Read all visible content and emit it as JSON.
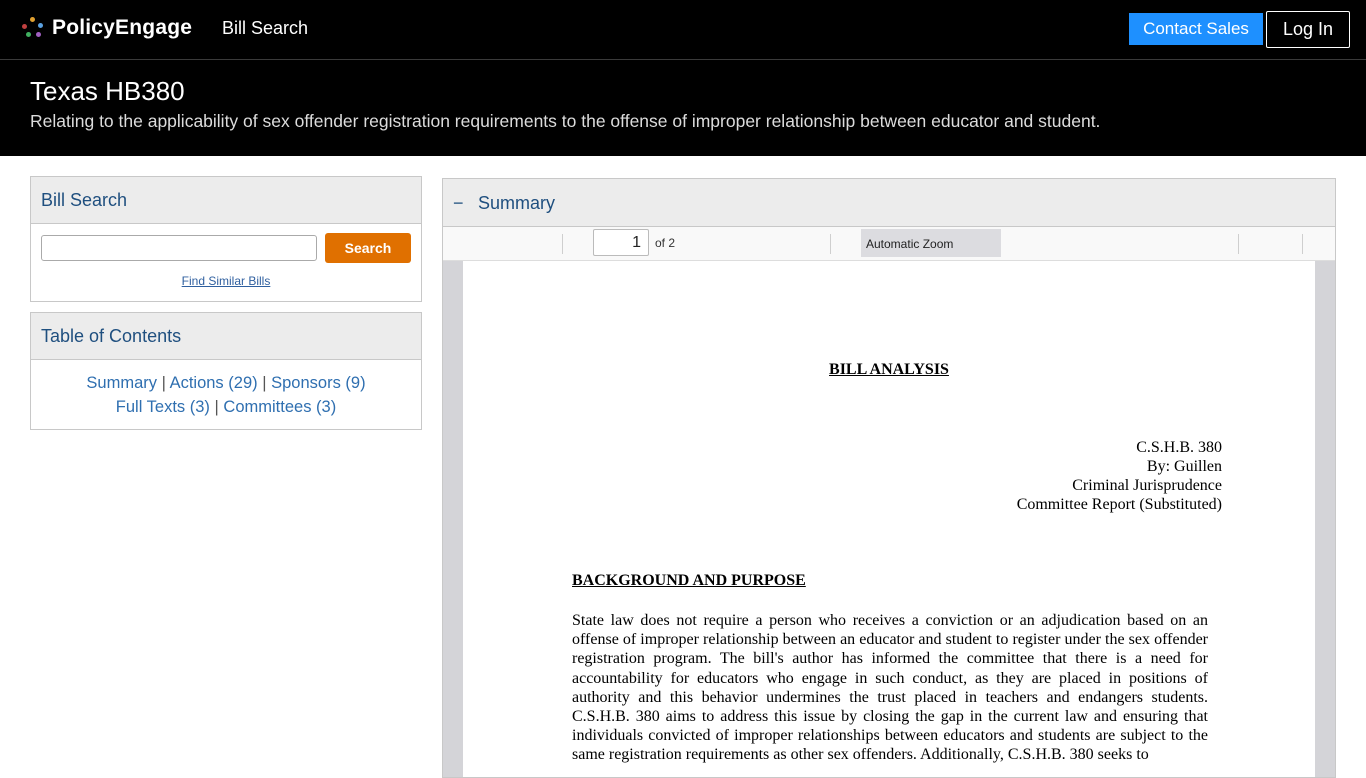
{
  "nav": {
    "brand": "PolicyEngage",
    "link": "Bill Search",
    "contact_label": "Contact Sales",
    "login_label": "Log In",
    "colors": {
      "bar": "#000000",
      "contact": "#1e90ff",
      "logo_dots": [
        "#e0a030",
        "#5aa0e0",
        "#c04040",
        "#40b060",
        "#a060c0"
      ]
    }
  },
  "bill": {
    "title": "Texas HB380",
    "description": "Relating to the applicability of sex offender registration requirements to the offense of improper relationship between educator and student."
  },
  "search_panel": {
    "title": "Bill Search",
    "input_value": "",
    "button_label": "Search",
    "similar_link": "Find Similar Bills"
  },
  "toc": {
    "title": "Table of Contents",
    "summary": "Summary",
    "actions": "Actions (29)",
    "sponsors": "Sponsors (9)",
    "full_texts": "Full Texts (3)",
    "committees": "Committees (3)",
    "separator": "|"
  },
  "summary": {
    "toggle_icon": "−",
    "title": "Summary",
    "pdf": {
      "page_current": "1",
      "page_total": "of 2",
      "zoom": "Automatic Zoom",
      "doc_title": "BILL ANALYSIS",
      "meta": [
        "C.S.H.B. 380",
        "By: Guillen",
        "Criminal Jurisprudence",
        "Committee Report (Substituted)"
      ],
      "section_heading": "BACKGROUND AND PURPOSE",
      "paragraph": "State law does not require a person who receives a conviction or an adjudication based on an offense of improper relationship between an educator and student to register under the sex offender registration program. The bill's author has informed the committee that there is a need for accountability for educators who engage in such conduct, as they are placed in positions of authority and this behavior undermines the trust placed in teachers and endangers students. C.S.H.B. 380 aims to address this issue by closing the gap in the current law and ensuring that individuals convicted of improper relationships between educators and students are subject to the same registration requirements as other sex offenders. Additionally, C.S.H.B. 380 seeks to"
    }
  }
}
